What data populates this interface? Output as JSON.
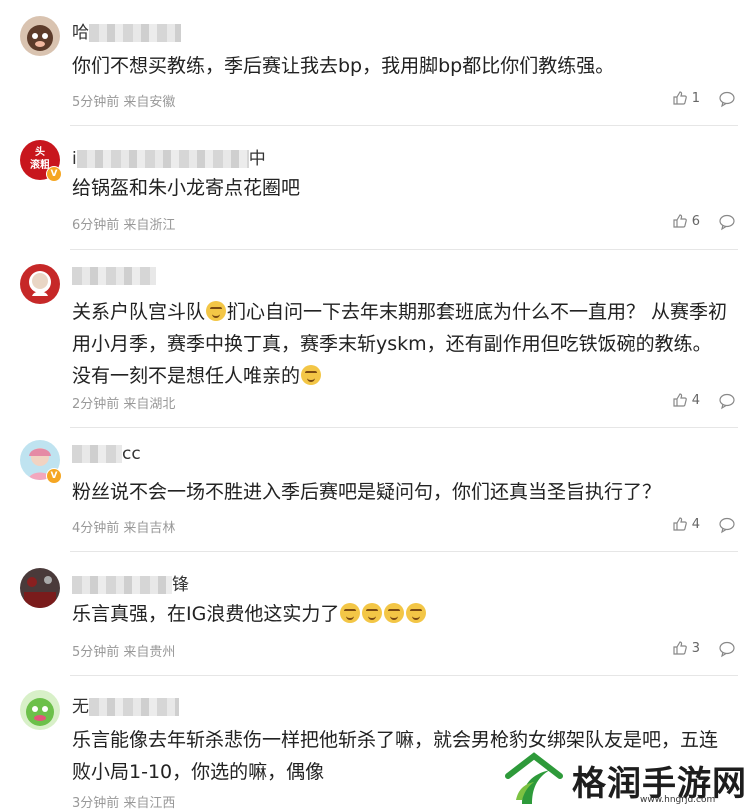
{
  "comments": [
    {
      "name_prefix": "哈",
      "name_suffix": "",
      "text": "你们不想买教练，季后赛让我去bp，我用脚bp都比你们教练强。",
      "time": "5分钟前",
      "location": "来自安徽",
      "likes": "1"
    },
    {
      "name_prefix": "i",
      "name_suffix": "中",
      "text": "给锅盔和朱小龙寄点花圈吧",
      "time": "6分钟前",
      "location": "来自浙江",
      "likes": "6"
    },
    {
      "name_prefix": "",
      "name_suffix": "",
      "text_a": "关系户队宫斗队",
      "text_b": "扪心自问一下去年末期那套班底为什么不一直用？ 从赛季初用小月季，赛季中换丁真，赛季末斩yskm，还有副作用但吃铁饭碗的教练。没有一刻不是想任人唯亲的",
      "time": "2分钟前",
      "location": "来自湖北",
      "likes": "4"
    },
    {
      "name_prefix": "",
      "name_suffix": "cc",
      "text": "粉丝说不会一场不胜进入季后赛吧是疑问句，你们还真当圣旨执行了？",
      "time": "4分钟前",
      "location": "来自吉林",
      "likes": "4"
    },
    {
      "name_prefix": "",
      "name_suffix": "锋",
      "text": "乐言真强，在IG浪费他这实力了",
      "time": "5分钟前",
      "location": "来自贵州",
      "likes": "3"
    },
    {
      "name_prefix": "无",
      "name_suffix": "",
      "text": "乐言能像去年斩杀悲伤一样把他斩杀了嘛，就会男枪豹女绑架队友是吧，五连败小局1-10，你选的嘛，偶像",
      "time": "3分钟前",
      "location": "来自江西",
      "likes": ""
    }
  ],
  "avatar2_text": [
    "头",
    "滚粗"
  ],
  "watermark": {
    "text": "格润手游网",
    "url": "www.hngrjd.com"
  },
  "colors": {
    "divider": "#e6e6e6",
    "meta": "#999999",
    "vip": "#f5a623",
    "brand_green": "#2e9a3a"
  }
}
